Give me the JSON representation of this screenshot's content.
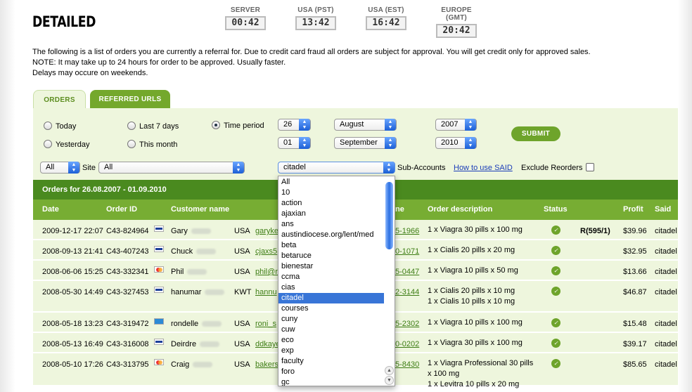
{
  "title": "DETAILED",
  "clocks": [
    {
      "label": "SERVER",
      "time": "00:42"
    },
    {
      "label": "USA (PST)",
      "time": "13:42"
    },
    {
      "label": "USA (EST)",
      "time": "16:42"
    },
    {
      "label": "EUROPE (GMT)",
      "time": "20:42"
    }
  ],
  "intro": {
    "line1": "The following is a list of orders you are currently a referral for. Due to credit card fraud all orders are subject for approval. You will get credit only for approved sales.",
    "line2": "NOTE: It may take up to 24 hours for order to be approved. Usually faster.",
    "line3": "Delays may occure on weekends."
  },
  "tabs": {
    "orders": "ORDERS",
    "referred_urls": "REFERRED URLS"
  },
  "filters": {
    "today": "Today",
    "yesterday": "Yesterday",
    "last7": "Last 7 days",
    "this_month": "This month",
    "time_period": "Time period",
    "selected_radio": "Time period",
    "from_day": "26",
    "from_month": "August",
    "from_year": "2007",
    "to_day": "01",
    "to_month": "September",
    "to_year": "2010",
    "submit": "SUBMIT",
    "type_select": "All",
    "site_label": "Site",
    "site_select": "All",
    "said_select": "citadel",
    "sub_accounts": "Sub-Accounts",
    "how_to_link": "How to use SAID",
    "exclude_reorders": "Exclude Reorders"
  },
  "orders_header": "Orders for 26.08.2007 - 01.09.2010",
  "columns": {
    "date": "Date",
    "order_id": "Order ID",
    "customer": "Customer name",
    "phone": "ne",
    "description": "Order description",
    "status": "Status",
    "profit": "Profit",
    "said": "Said"
  },
  "rows": [
    {
      "date": "2009-12-17 22:07",
      "id": "C43-824964",
      "card": "visa",
      "name": "Gary",
      "country": "USA",
      "email": "garyke",
      "phone": "5-1966",
      "desc": [
        "1 x Viagra 30 pills x 100 mg"
      ],
      "extra": "R(595/1)",
      "profit": "$39.96",
      "said": "citadel"
    },
    {
      "date": "2008-09-13 21:41",
      "id": "C43-407243",
      "card": "visa",
      "name": "Chuck",
      "country": "USA",
      "email": "cjaxs5",
      "phone": "0-1071",
      "desc": [
        "1 x Cialis 20 pills x 20 mg"
      ],
      "extra": "",
      "profit": "$32.95",
      "said": "citadel"
    },
    {
      "date": "2008-06-06 15:25",
      "id": "C43-332341",
      "card": "mc",
      "name": "Phil",
      "country": "USA",
      "email": "phil@r",
      "phone": "5-0447",
      "desc": [
        "1 x Viagra 10 pills x 50 mg"
      ],
      "extra": "",
      "profit": "$13.66",
      "said": "citadel"
    },
    {
      "date": "2008-05-30 14:49",
      "id": "C43-327453",
      "card": "visa",
      "name": "hanumar",
      "country": "KWT",
      "email": "hannu",
      "phone": "2-3144",
      "desc": [
        "1 x Cialis 20 pills x 10 mg",
        "1 x Cialis 10 pills x 10 mg"
      ],
      "extra": "",
      "profit": "$46.87",
      "said": "citadel"
    },
    {
      "date": "2008-05-18 13:23",
      "id": "C43-319472",
      "card": "amex",
      "name": "rondelle",
      "country": "USA",
      "email": "roni_s",
      "phone": "5-2302",
      "desc": [
        "1 x Viagra 10 pills x 100 mg"
      ],
      "extra": "",
      "profit": "$15.48",
      "said": "citadel"
    },
    {
      "date": "2008-05-13 16:49",
      "id": "C43-316008",
      "card": "visa",
      "name": "Deirdre",
      "country": "USA",
      "email": "ddkaye",
      "phone": "0-0202",
      "desc": [
        "1 x Viagra 30 pills x 100 mg"
      ],
      "extra": "",
      "profit": "$39.17",
      "said": "citadel"
    },
    {
      "date": "2008-05-10 17:26",
      "id": "C43-313795",
      "card": "mc",
      "name": "Craig",
      "country": "USA",
      "email": "bakers",
      "phone": "5-8430",
      "desc": [
        "1 x Viagra Professional 30 pills",
        "x 100 mg",
        "1 x Levitra 10 pills x 20 mg"
      ],
      "extra": "",
      "profit": "$85.65",
      "said": "citadel"
    }
  ],
  "said_options": [
    "All",
    "10",
    "action",
    "ajaxian",
    "ans",
    "austindiocese.org/lent/med",
    "beta",
    "betaruce",
    "bienestar",
    "ccma",
    "cias",
    "citadel",
    "courses",
    "cuny",
    "cuw",
    "eco",
    "exp",
    "faculty",
    "foro",
    "gc"
  ],
  "said_highlighted": "citadel",
  "colors": {
    "banner": "#4a8a1f",
    "header": "#77ad33",
    "panel": "#eef6dd",
    "highlight": "#3875d7"
  }
}
